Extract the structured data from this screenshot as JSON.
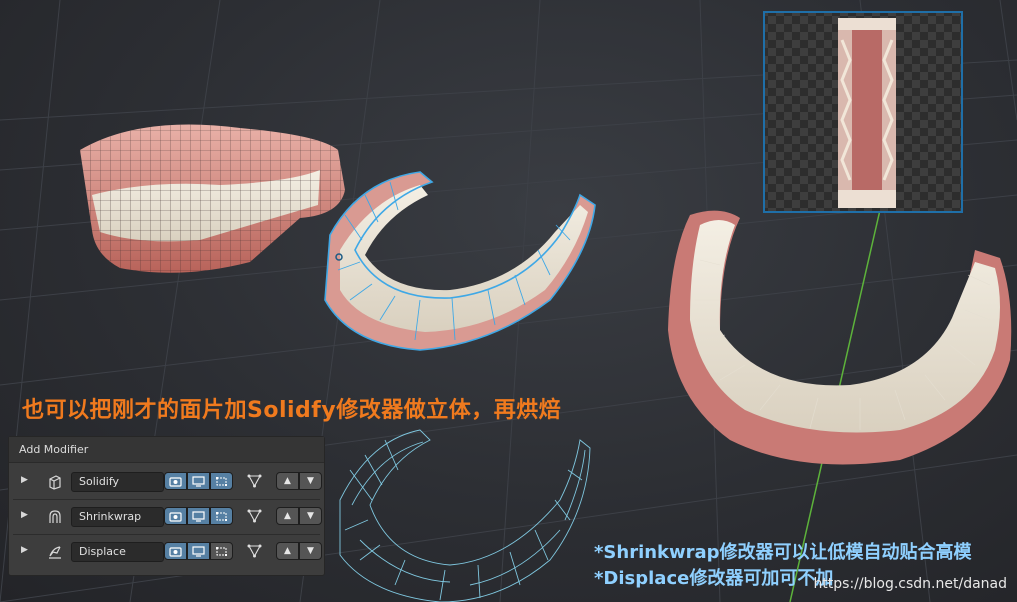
{
  "overlay": {
    "title": "也可以把刚才的面片加Solidfy修改器做立体，再烘焙",
    "notes": [
      "*Shrinkwrap修改器可以让低模自动贴合高模",
      "*Displace修改器可加可不加"
    ],
    "watermark": "https://blog.csdn.net/danad"
  },
  "panel": {
    "header": "Add Modifier",
    "modifiers": [
      {
        "name": "Solidify",
        "icon": "solidify-icon"
      },
      {
        "name": "Shrinkwrap",
        "icon": "shrinkwrap-icon"
      },
      {
        "name": "Displace",
        "icon": "displace-icon"
      }
    ]
  },
  "colors": {
    "title": "#f07a1e",
    "notes": "#8fd0ff",
    "selection": "#3fa8e6",
    "active_toggle": "#5680a3"
  }
}
